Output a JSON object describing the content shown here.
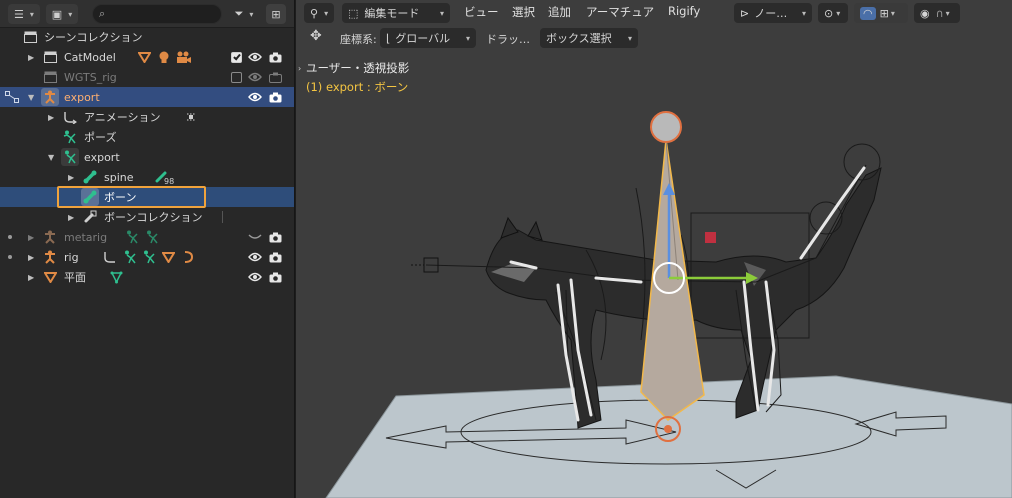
{
  "outliner": {
    "search": {
      "placeholder": ""
    },
    "rows": [
      {
        "label": "シーンコレクション"
      },
      {
        "label": "CatModel"
      },
      {
        "label": "WGTS_rig"
      },
      {
        "label": "export"
      },
      {
        "label": "アニメーション"
      },
      {
        "label": "ポーズ"
      },
      {
        "label": "export"
      },
      {
        "label": "spine",
        "badge": "98"
      },
      {
        "label": "ボーン"
      },
      {
        "label": "ボーンコレクション"
      },
      {
        "label": "metarig"
      },
      {
        "label": "rig"
      },
      {
        "label": "平面"
      }
    ]
  },
  "viewport": {
    "header": {
      "mode": "編集モード",
      "menus": [
        "ビュー",
        "選択",
        "追加",
        "アーマチュア",
        "Rigify"
      ],
      "pivot": "ノー…"
    },
    "tool": {
      "orientation_label": "座標系:",
      "orientation_value": "グローバル",
      "drag_label": "ドラッ…",
      "drag_value": "ボックス選択"
    },
    "overlay": {
      "view_name": "ユーザー・透視投影",
      "active": "(1) export : ボーン"
    }
  },
  "colors": {
    "selection_blue": "#334d80",
    "highlight_orange": "#f0a33c",
    "armature_orange": "#e08a45",
    "bone_green": "#2fbf8f",
    "active_text": "#f4c542"
  }
}
